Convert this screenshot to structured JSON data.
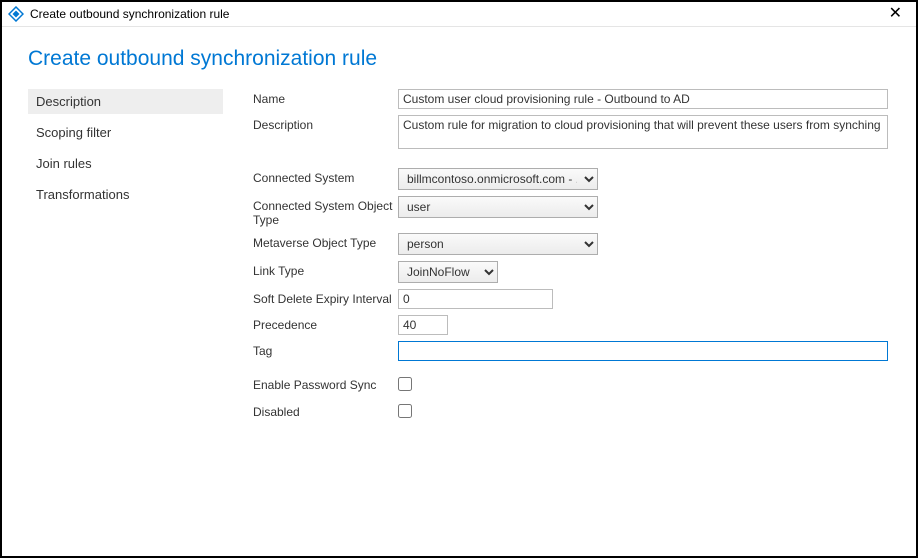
{
  "window": {
    "title": "Create outbound synchronization rule"
  },
  "heading": "Create outbound synchronization rule",
  "sidebar": {
    "items": [
      {
        "label": "Description"
      },
      {
        "label": "Scoping filter"
      },
      {
        "label": "Join rules"
      },
      {
        "label": "Transformations"
      }
    ]
  },
  "form": {
    "nameLabel": "Name",
    "nameValue": "Custom user cloud provisioning rule - Outbound to AD",
    "descLabel": "Description",
    "descValue": "Custom rule for migration to cloud provisioning that will prevent these users from synching",
    "csLabel": "Connected System",
    "csValue": "billmcontoso.onmicrosoft.com - ...",
    "csoLabel": "Connected System Object Type",
    "csoValue": "user",
    "mvLabel": "Metaverse Object Type",
    "mvValue": "person",
    "linkLabel": "Link Type",
    "linkValue": "JoinNoFlow",
    "softDelLabel": "Soft Delete Expiry Interval",
    "softDelValue": "0",
    "precLabel": "Precedence",
    "precValue": "40",
    "tagLabel": "Tag",
    "tagValue": "",
    "pwdSyncLabel": "Enable Password Sync",
    "disabledLabel": "Disabled"
  }
}
